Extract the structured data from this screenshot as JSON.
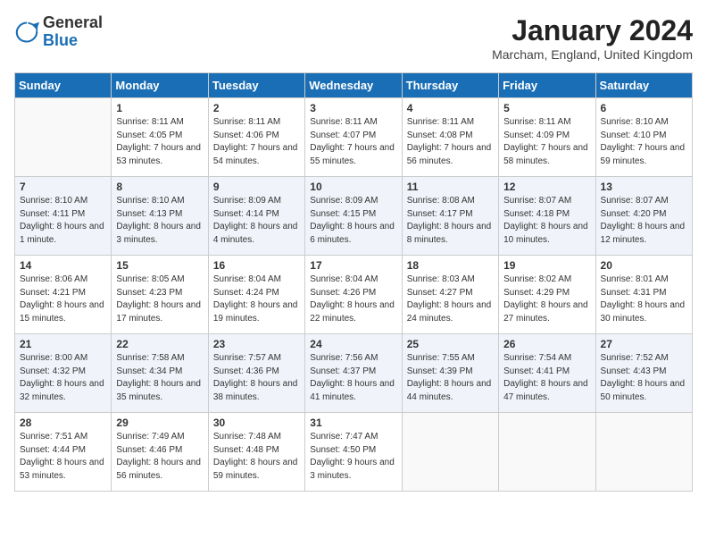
{
  "logo": {
    "general": "General",
    "blue": "Blue"
  },
  "header": {
    "month": "January 2024",
    "location": "Marcham, England, United Kingdom"
  },
  "days_of_week": [
    "Sunday",
    "Monday",
    "Tuesday",
    "Wednesday",
    "Thursday",
    "Friday",
    "Saturday"
  ],
  "weeks": [
    [
      {
        "num": "",
        "empty": true
      },
      {
        "num": "1",
        "sunrise": "8:11 AM",
        "sunset": "4:05 PM",
        "daylight": "7 hours and 53 minutes."
      },
      {
        "num": "2",
        "sunrise": "8:11 AM",
        "sunset": "4:06 PM",
        "daylight": "7 hours and 54 minutes."
      },
      {
        "num": "3",
        "sunrise": "8:11 AM",
        "sunset": "4:07 PM",
        "daylight": "7 hours and 55 minutes."
      },
      {
        "num": "4",
        "sunrise": "8:11 AM",
        "sunset": "4:08 PM",
        "daylight": "7 hours and 56 minutes."
      },
      {
        "num": "5",
        "sunrise": "8:11 AM",
        "sunset": "4:09 PM",
        "daylight": "7 hours and 58 minutes."
      },
      {
        "num": "6",
        "sunrise": "8:10 AM",
        "sunset": "4:10 PM",
        "daylight": "7 hours and 59 minutes."
      }
    ],
    [
      {
        "num": "7",
        "sunrise": "8:10 AM",
        "sunset": "4:11 PM",
        "daylight": "8 hours and 1 minute."
      },
      {
        "num": "8",
        "sunrise": "8:10 AM",
        "sunset": "4:13 PM",
        "daylight": "8 hours and 3 minutes."
      },
      {
        "num": "9",
        "sunrise": "8:09 AM",
        "sunset": "4:14 PM",
        "daylight": "8 hours and 4 minutes."
      },
      {
        "num": "10",
        "sunrise": "8:09 AM",
        "sunset": "4:15 PM",
        "daylight": "8 hours and 6 minutes."
      },
      {
        "num": "11",
        "sunrise": "8:08 AM",
        "sunset": "4:17 PM",
        "daylight": "8 hours and 8 minutes."
      },
      {
        "num": "12",
        "sunrise": "8:07 AM",
        "sunset": "4:18 PM",
        "daylight": "8 hours and 10 minutes."
      },
      {
        "num": "13",
        "sunrise": "8:07 AM",
        "sunset": "4:20 PM",
        "daylight": "8 hours and 12 minutes."
      }
    ],
    [
      {
        "num": "14",
        "sunrise": "8:06 AM",
        "sunset": "4:21 PM",
        "daylight": "8 hours and 15 minutes."
      },
      {
        "num": "15",
        "sunrise": "8:05 AM",
        "sunset": "4:23 PM",
        "daylight": "8 hours and 17 minutes."
      },
      {
        "num": "16",
        "sunrise": "8:04 AM",
        "sunset": "4:24 PM",
        "daylight": "8 hours and 19 minutes."
      },
      {
        "num": "17",
        "sunrise": "8:04 AM",
        "sunset": "4:26 PM",
        "daylight": "8 hours and 22 minutes."
      },
      {
        "num": "18",
        "sunrise": "8:03 AM",
        "sunset": "4:27 PM",
        "daylight": "8 hours and 24 minutes."
      },
      {
        "num": "19",
        "sunrise": "8:02 AM",
        "sunset": "4:29 PM",
        "daylight": "8 hours and 27 minutes."
      },
      {
        "num": "20",
        "sunrise": "8:01 AM",
        "sunset": "4:31 PM",
        "daylight": "8 hours and 30 minutes."
      }
    ],
    [
      {
        "num": "21",
        "sunrise": "8:00 AM",
        "sunset": "4:32 PM",
        "daylight": "8 hours and 32 minutes."
      },
      {
        "num": "22",
        "sunrise": "7:58 AM",
        "sunset": "4:34 PM",
        "daylight": "8 hours and 35 minutes."
      },
      {
        "num": "23",
        "sunrise": "7:57 AM",
        "sunset": "4:36 PM",
        "daylight": "8 hours and 38 minutes."
      },
      {
        "num": "24",
        "sunrise": "7:56 AM",
        "sunset": "4:37 PM",
        "daylight": "8 hours and 41 minutes."
      },
      {
        "num": "25",
        "sunrise": "7:55 AM",
        "sunset": "4:39 PM",
        "daylight": "8 hours and 44 minutes."
      },
      {
        "num": "26",
        "sunrise": "7:54 AM",
        "sunset": "4:41 PM",
        "daylight": "8 hours and 47 minutes."
      },
      {
        "num": "27",
        "sunrise": "7:52 AM",
        "sunset": "4:43 PM",
        "daylight": "8 hours and 50 minutes."
      }
    ],
    [
      {
        "num": "28",
        "sunrise": "7:51 AM",
        "sunset": "4:44 PM",
        "daylight": "8 hours and 53 minutes."
      },
      {
        "num": "29",
        "sunrise": "7:49 AM",
        "sunset": "4:46 PM",
        "daylight": "8 hours and 56 minutes."
      },
      {
        "num": "30",
        "sunrise": "7:48 AM",
        "sunset": "4:48 PM",
        "daylight": "8 hours and 59 minutes."
      },
      {
        "num": "31",
        "sunrise": "7:47 AM",
        "sunset": "4:50 PM",
        "daylight": "9 hours and 3 minutes."
      },
      {
        "num": "",
        "empty": true
      },
      {
        "num": "",
        "empty": true
      },
      {
        "num": "",
        "empty": true
      }
    ]
  ]
}
